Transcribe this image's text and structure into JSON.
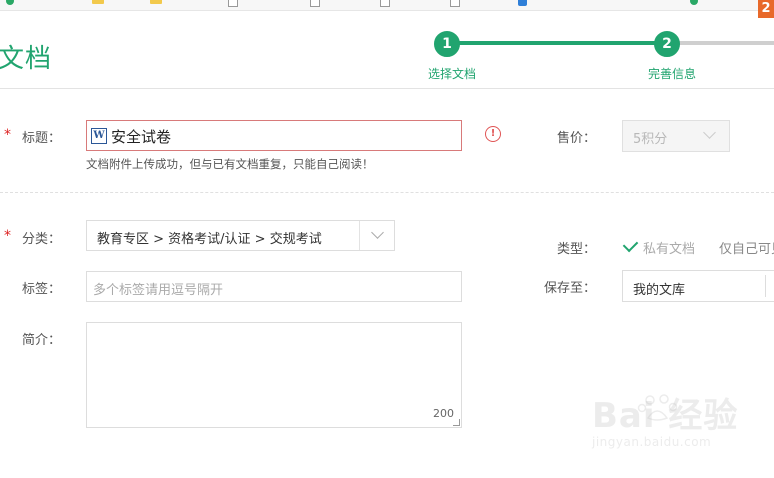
{
  "header": {
    "page_title": "文档",
    "top_badge": "2"
  },
  "steps": [
    {
      "number": "1",
      "label": "选择文档"
    },
    {
      "number": "2",
      "label": "完善信息"
    }
  ],
  "form": {
    "title": {
      "label": "标题：",
      "required_mark": "*",
      "value": "安全试卷",
      "file_icon": "W",
      "warning_icon": "!",
      "message": "文档附件上传成功，但与已有文档重复，只能自己阅读！"
    },
    "price": {
      "label": "售价：",
      "value": "5积分"
    },
    "category": {
      "label": "分类：",
      "required_mark": "*",
      "path": "教育专区 > 资格考试/认证 > 交规考试"
    },
    "type": {
      "label": "类型：",
      "private_option": "私有文档",
      "note": "仅自己可见"
    },
    "tags": {
      "label": "标签：",
      "placeholder": "多个标签请用逗号隔开"
    },
    "save_to": {
      "label": "保存至：",
      "value": "我的文库"
    },
    "intro": {
      "label": "简介：",
      "remaining": "200"
    }
  },
  "watermark": {
    "main": "Bai 经验",
    "sub": "jingyan.baidu.com"
  },
  "colors": {
    "accent": "#21a46f",
    "error": "#e05555",
    "required": "#d22222"
  }
}
